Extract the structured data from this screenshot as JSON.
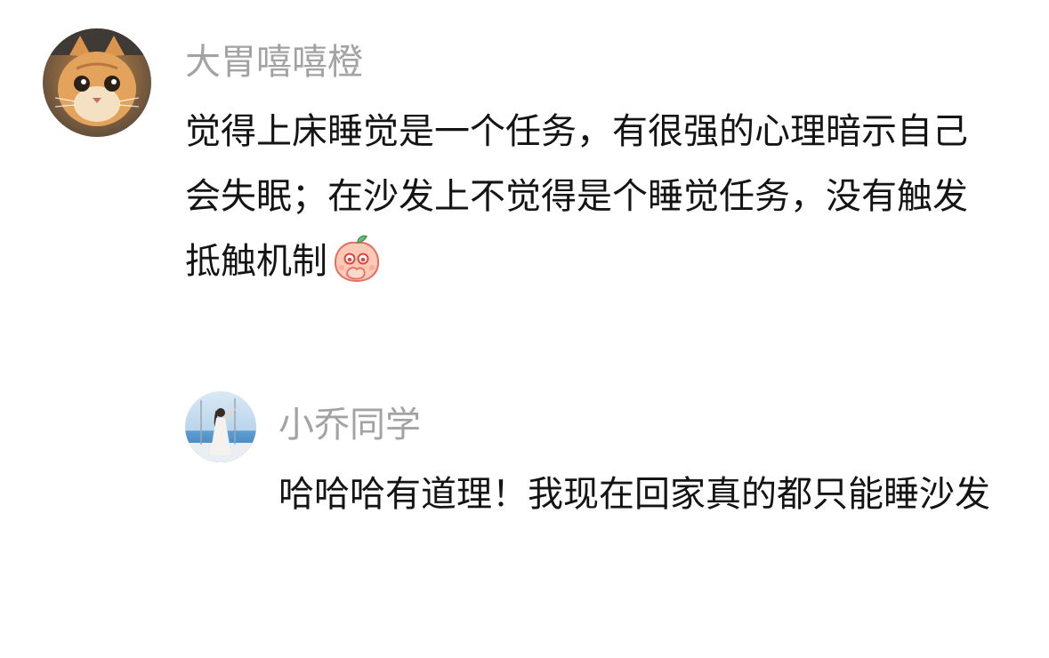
{
  "comments": [
    {
      "user": "大胃嘻嘻橙",
      "avatar_icon": "orange-cat-avatar",
      "text": "觉得上床睡觉是一个任务，有很强的心理暗示自己会失眠；在沙发上不觉得是个睡觉任务，没有触发抵触机制",
      "emoji_icon": "peach-covering-mouth-emoji",
      "replies": [
        {
          "user": "小乔同学",
          "avatar_icon": "girl-by-sea-avatar",
          "text": "哈哈哈有道理！我现在回家真的都只能睡沙发"
        }
      ]
    }
  ],
  "colors": {
    "username": "#a3a3a3",
    "body_text": "#141414",
    "background": "#ffffff"
  }
}
